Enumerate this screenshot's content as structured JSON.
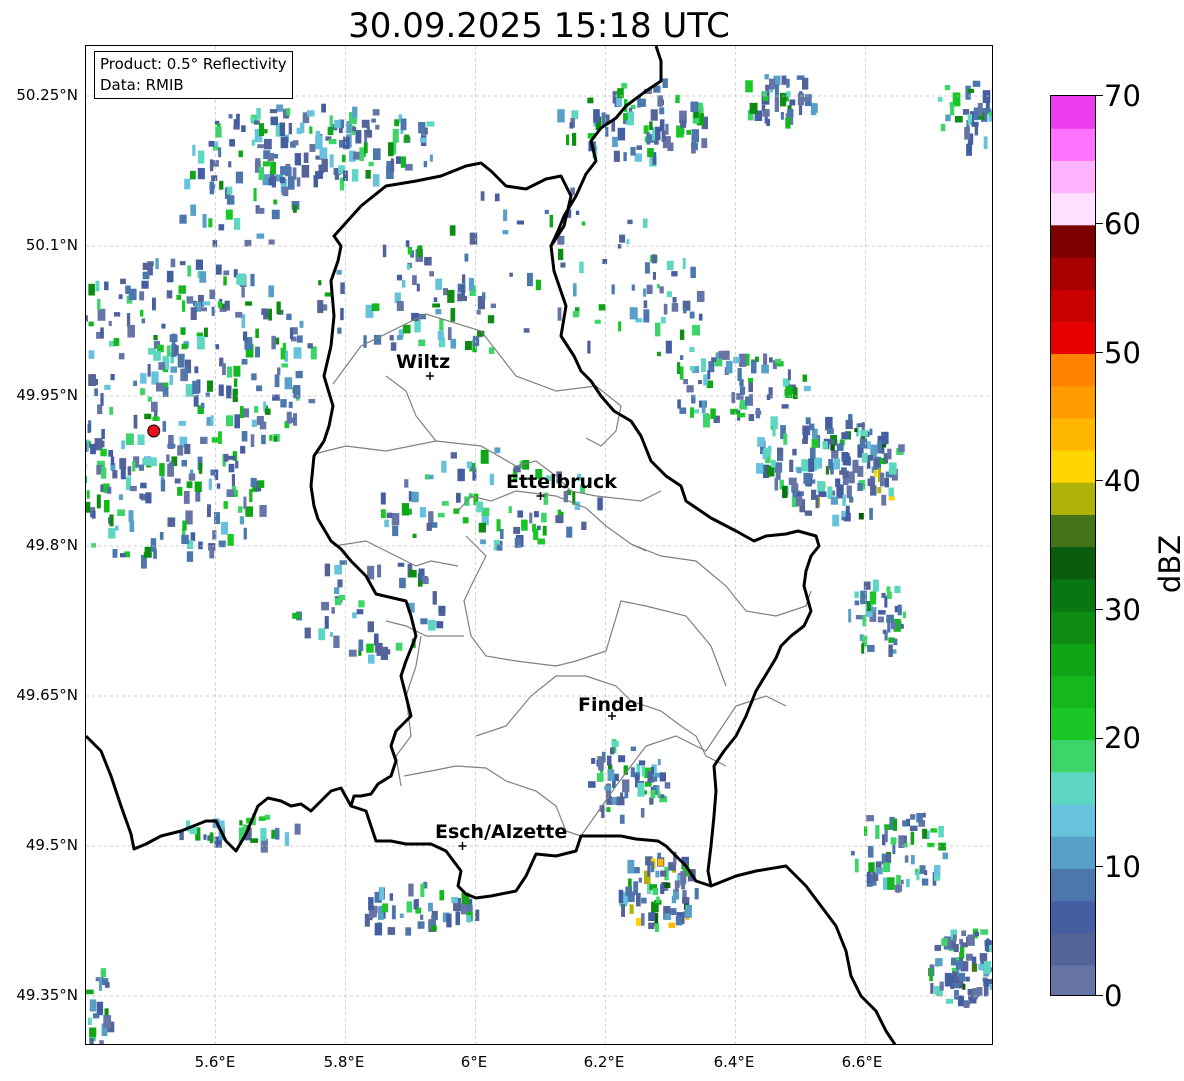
{
  "title": "30.09.2025 15:18 UTC",
  "info_box": {
    "product": "Product: 0.5° Reflectivity",
    "data_source": "Data: RMIB"
  },
  "axes": {
    "lat_labels": [
      "50.25°N",
      "50.1°N",
      "49.95°N",
      "49.8°N",
      "49.65°N",
      "49.5°N",
      "49.35°N"
    ],
    "lon_labels": [
      "5.6°E",
      "5.8°E",
      "6°E",
      "6.2°E",
      "6.4°E",
      "6.6°E"
    ]
  },
  "cities": [
    {
      "name": "Wiltz",
      "lon": 5.93,
      "lat": 49.97
    },
    {
      "name": "Ettelbruck",
      "lon": 6.1,
      "lat": 49.85
    },
    {
      "name": "Findel",
      "lon": 6.21,
      "lat": 49.63
    },
    {
      "name": "Esch/Alzette",
      "lon": 5.98,
      "lat": 49.5
    }
  ],
  "radar_site": {
    "lon": 5.505,
    "lat": 49.915,
    "color": "#e8121c"
  },
  "colorbar": {
    "label": "dBZ",
    "ticks": [
      "0",
      "10",
      "20",
      "30",
      "40",
      "50",
      "60",
      "70"
    ],
    "min": 0,
    "max": 70,
    "colors": [
      "#6675a6",
      "#546499",
      "#445ea1",
      "#4b77ac",
      "#58a0c7",
      "#67c2dd",
      "#5ed7c2",
      "#3dd46a",
      "#19c826",
      "#14b81e",
      "#10a516",
      "#0e8b12",
      "#0a7611",
      "#0b5c0d",
      "#44741a",
      "#aeb209",
      "#ffd400",
      "#ffb700",
      "#ff9d00",
      "#ff8200",
      "#e60000",
      "#c80000",
      "#a60000",
      "#7d0000",
      "#ffe0ff",
      "#ffb2ff",
      "#ff73ff",
      "#ec3cf0"
    ]
  },
  "colors": {
    "border": "#000000",
    "canton": "#808080",
    "grid": "#c0c0c0"
  }
}
